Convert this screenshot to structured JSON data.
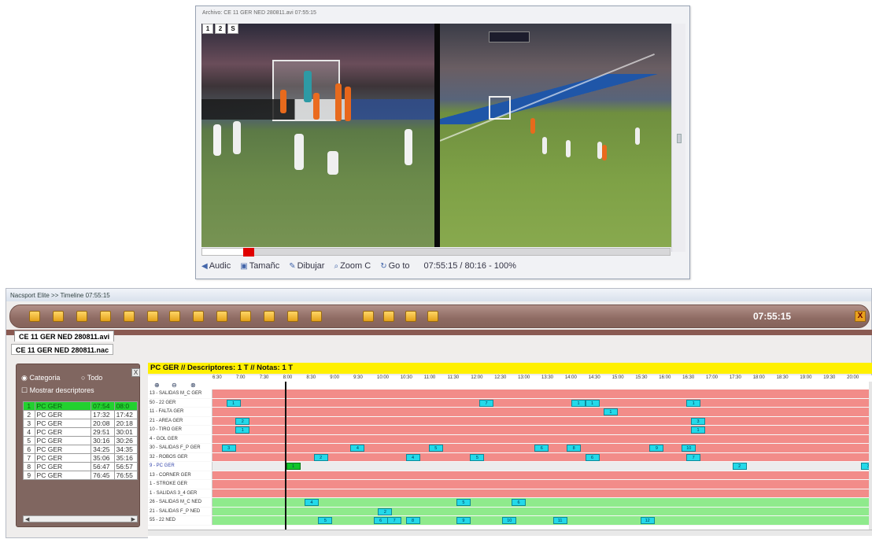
{
  "player": {
    "title": "Archivo: CE 11 GER NED 280811.avi 07:55:15",
    "view_buttons": [
      "1",
      "2",
      "S"
    ],
    "progress_fraction": 0.1,
    "toolbar": {
      "audio": "Audic",
      "size": "Tamañc",
      "draw": "Dibujar",
      "zoom": "Zoom C",
      "goto": "Go to",
      "time": "07:55:15 / 80:16 - 100%"
    }
  },
  "main": {
    "window_title": "Nacsport Elite  >>  Timeline 07:55:15",
    "clock": "07:55:15",
    "close": "X",
    "file_tabs": [
      "CE 11 GER NED 280811.avi",
      "CE 11 GER NED 280811.nac"
    ]
  },
  "left_panel": {
    "radio_categoria": "Categoria",
    "radio_todo": "Todo",
    "checkbox": "Mostrar descriptores",
    "close": "X",
    "rows": [
      {
        "n": "1",
        "cat": "PC GER",
        "t1": "07:54",
        "t2": "08:0"
      },
      {
        "n": "2",
        "cat": "PC GER",
        "t1": "17:32",
        "t2": "17:42"
      },
      {
        "n": "3",
        "cat": "PC GER",
        "t1": "20:08",
        "t2": "20:18"
      },
      {
        "n": "4",
        "cat": "PC GER",
        "t1": "29:51",
        "t2": "30:01"
      },
      {
        "n": "5",
        "cat": "PC GER",
        "t1": "30:16",
        "t2": "30:26"
      },
      {
        "n": "6",
        "cat": "PC GER",
        "t1": "34:25",
        "t2": "34:35"
      },
      {
        "n": "7",
        "cat": "PC GER",
        "t1": "35:06",
        "t2": "35:16"
      },
      {
        "n": "8",
        "cat": "PC GER",
        "t1": "56:47",
        "t2": "56:57"
      },
      {
        "n": "9",
        "cat": "PC GER",
        "t1": "76:45",
        "t2": "76:55"
      }
    ]
  },
  "timeline": {
    "header": "PC GER // Descriptores: 1 T // Notas: 1 T",
    "ruler": [
      "6:30",
      "7:00",
      "7:30",
      "8:00",
      "8:30",
      "9:00",
      "9:30",
      "10:00",
      "10:30",
      "11:00",
      "11:30",
      "12:00",
      "12:30",
      "13:00",
      "13:30",
      "14:00",
      "14:30",
      "15:00",
      "15:30",
      "16:00",
      "16:30",
      "17:00",
      "17:30",
      "18:00",
      "18:30",
      "19:00",
      "19:30",
      "20:00"
    ],
    "tracks": [
      {
        "label": "13 - SALIDAS M_C GER",
        "color": "red",
        "events": []
      },
      {
        "label": "50 - 22 GER",
        "color": "red",
        "events": [
          {
            "x": 6.6,
            "label": "1"
          },
          {
            "x": 12.1,
            "label": "7"
          },
          {
            "x": 14.1,
            "label": "1"
          },
          {
            "x": 14.4,
            "label": "1"
          },
          {
            "x": 16.6,
            "label": "1"
          }
        ]
      },
      {
        "label": "11 - FALTA GER",
        "color": "red",
        "events": [
          {
            "x": 14.8,
            "label": "1"
          }
        ]
      },
      {
        "label": "21 - AREA GER",
        "color": "red",
        "events": [
          {
            "x": 6.8,
            "label": "2"
          },
          {
            "x": 16.7,
            "label": "3"
          }
        ]
      },
      {
        "label": "10 - TIRO GER",
        "color": "red",
        "events": [
          {
            "x": 6.8,
            "label": "1"
          },
          {
            "x": 16.7,
            "label": "1"
          }
        ]
      },
      {
        "label": "4 - GOL GER",
        "color": "red",
        "events": []
      },
      {
        "label": "30 - SALIDAS F_P GER",
        "color": "red",
        "events": [
          {
            "x": 6.5,
            "label": "3"
          },
          {
            "x": 9.3,
            "label": "4"
          },
          {
            "x": 11.0,
            "label": "5"
          },
          {
            "x": 13.3,
            "label": "6"
          },
          {
            "x": 14.0,
            "label": "8"
          },
          {
            "x": 15.8,
            "label": "9"
          },
          {
            "x": 16.5,
            "label": "10"
          }
        ]
      },
      {
        "label": "32 - ROBOS GER",
        "color": "red",
        "events": [
          {
            "x": 8.5,
            "label": "2"
          },
          {
            "x": 10.5,
            "label": "4"
          },
          {
            "x": 11.9,
            "label": "5"
          },
          {
            "x": 14.4,
            "label": "6"
          },
          {
            "x": 16.6,
            "label": "7"
          }
        ]
      },
      {
        "label": "9 - PC GER",
        "color": "sel",
        "events": [
          {
            "x": 7.9,
            "label": "1",
            "first": true
          },
          {
            "x": 17.6,
            "label": "2"
          },
          {
            "x": 20.4,
            "label": "3"
          }
        ]
      },
      {
        "label": "13 - CORNER GER",
        "color": "red",
        "events": []
      },
      {
        "label": "1 - STROKE GER",
        "color": "red",
        "events": []
      },
      {
        "label": "1 - SALIDAS 3_4 GER",
        "color": "red",
        "events": []
      },
      {
        "label": "26 - SALIDAS M_C NED",
        "color": "green",
        "events": [
          {
            "x": 8.3,
            "label": "4"
          },
          {
            "x": 11.6,
            "label": "5"
          },
          {
            "x": 12.8,
            "label": "6"
          }
        ]
      },
      {
        "label": "21 - SALIDAS F_P NED",
        "color": "green",
        "events": [
          {
            "x": 9.9,
            "label": "2"
          }
        ]
      },
      {
        "label": "55 - 22 NED",
        "color": "green",
        "events": [
          {
            "x": 8.6,
            "label": "5"
          },
          {
            "x": 9.8,
            "label": "6"
          },
          {
            "x": 10.1,
            "label": "7"
          },
          {
            "x": 10.5,
            "label": "8"
          },
          {
            "x": 11.6,
            "label": "9"
          },
          {
            "x": 12.6,
            "label": "10"
          },
          {
            "x": 13.7,
            "label": "11"
          },
          {
            "x": 15.6,
            "label": "12"
          }
        ]
      }
    ]
  }
}
